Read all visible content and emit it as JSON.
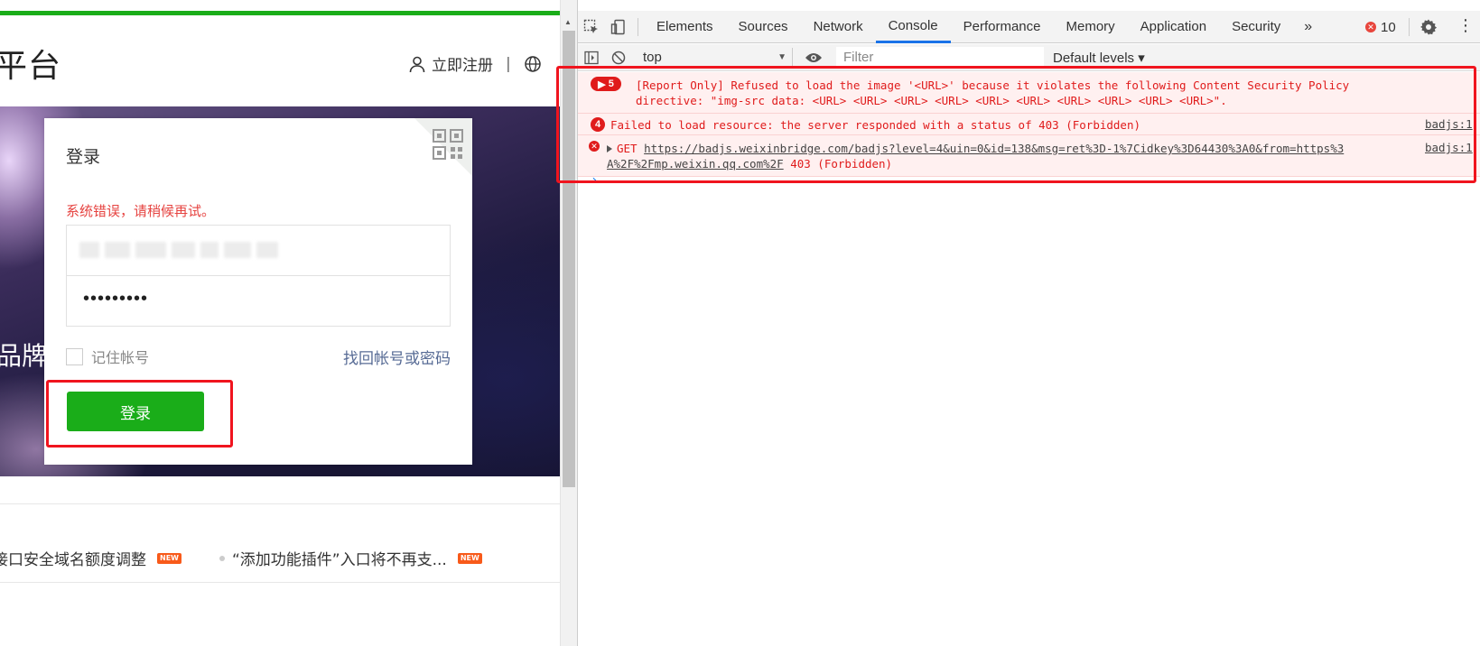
{
  "page": {
    "site_title": "平台",
    "register_label": "立即注册",
    "separator": "|",
    "banner_text": "品牌",
    "login": {
      "title": "登录",
      "error": "系统错误，请稍候再试。",
      "password_masked": "•••••••••",
      "remember_label": "记住帐号",
      "forgot_label": "找回帐号或密码",
      "submit_label": "登录"
    },
    "news": [
      {
        "text": "接口安全域名额度调整",
        "badge": "NEW"
      },
      {
        "text": "“添加功能插件”入口将不再支...",
        "badge": "NEW"
      }
    ]
  },
  "devtools": {
    "tabs": [
      "Elements",
      "Sources",
      "Network",
      "Console",
      "Performance",
      "Memory",
      "Application",
      "Security"
    ],
    "active_tab": "Console",
    "more_label": "»",
    "error_count": "10",
    "context": "top",
    "filter_placeholder": "Filter",
    "levels_label": "Default levels ▾",
    "messages": [
      {
        "count": "5",
        "text": "[Report Only] Refused to load the image '<URL>' because it violates the following Content Security Policy\ndirective: \"img-src data: <URL> <URL> <URL> <URL> <URL> <URL> <URL> <URL> <URL> <URL>\"."
      },
      {
        "count": "4",
        "text": "Failed to load resource: the server responded with a status of 403 (Forbidden)",
        "source": "badjs:1"
      },
      {
        "method": "GET",
        "url_line1": "https://badjs.weixinbridge.com/badjs?level=4&uin=0&id=138&msg=ret%3D-1%7Cidkey%3D64430%3A0&from=https%3",
        "url_line2": "A%2F%2Fmp.weixin.qq.com%2F",
        "status": "403 (Forbidden)",
        "source": "badjs:1"
      }
    ],
    "prompt": "›"
  },
  "colors": {
    "brand_green": "#1aad19",
    "error_red": "#e01b1b",
    "highlight_red": "#f0141e",
    "link_blue": "#576b95",
    "devtools_accent": "#1a73e8"
  }
}
